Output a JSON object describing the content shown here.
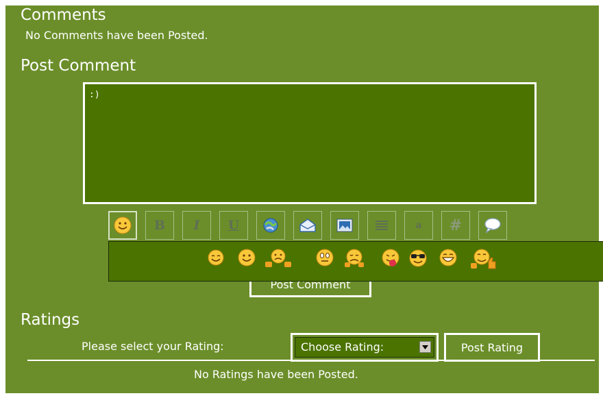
{
  "comments": {
    "title": "Comments",
    "empty_message": "No Comments have been Posted."
  },
  "post_comment": {
    "title": "Post Comment",
    "textarea_value": ":)",
    "submit_label": "Post Comment"
  },
  "toolbar": {
    "buttons": [
      "smiley-icon",
      "bold-icon",
      "italic-icon",
      "underline-icon",
      "link-icon",
      "email-icon",
      "image-icon",
      "align-icon",
      "font-icon",
      "code-icon",
      "quote-icon"
    ],
    "bold_glyph": "B",
    "italic_glyph": "I",
    "underline_glyph": "U",
    "font_glyph": "a",
    "code_glyph": "#"
  },
  "smileys": [
    "smile",
    "happy",
    "thumbs-down",
    "worried",
    "unhappy",
    "tongue",
    "cool",
    "grin",
    "thumbs-up"
  ],
  "ratings": {
    "title": "Ratings",
    "prompt": "Please select your Rating:",
    "select_value": "Choose Rating:",
    "submit_label": "Post Rating",
    "empty_message": "No Ratings have been Posted."
  },
  "colors": {
    "background": "#6b8e2a",
    "dark_panel": "#4b7300",
    "text": "#ffffff"
  }
}
